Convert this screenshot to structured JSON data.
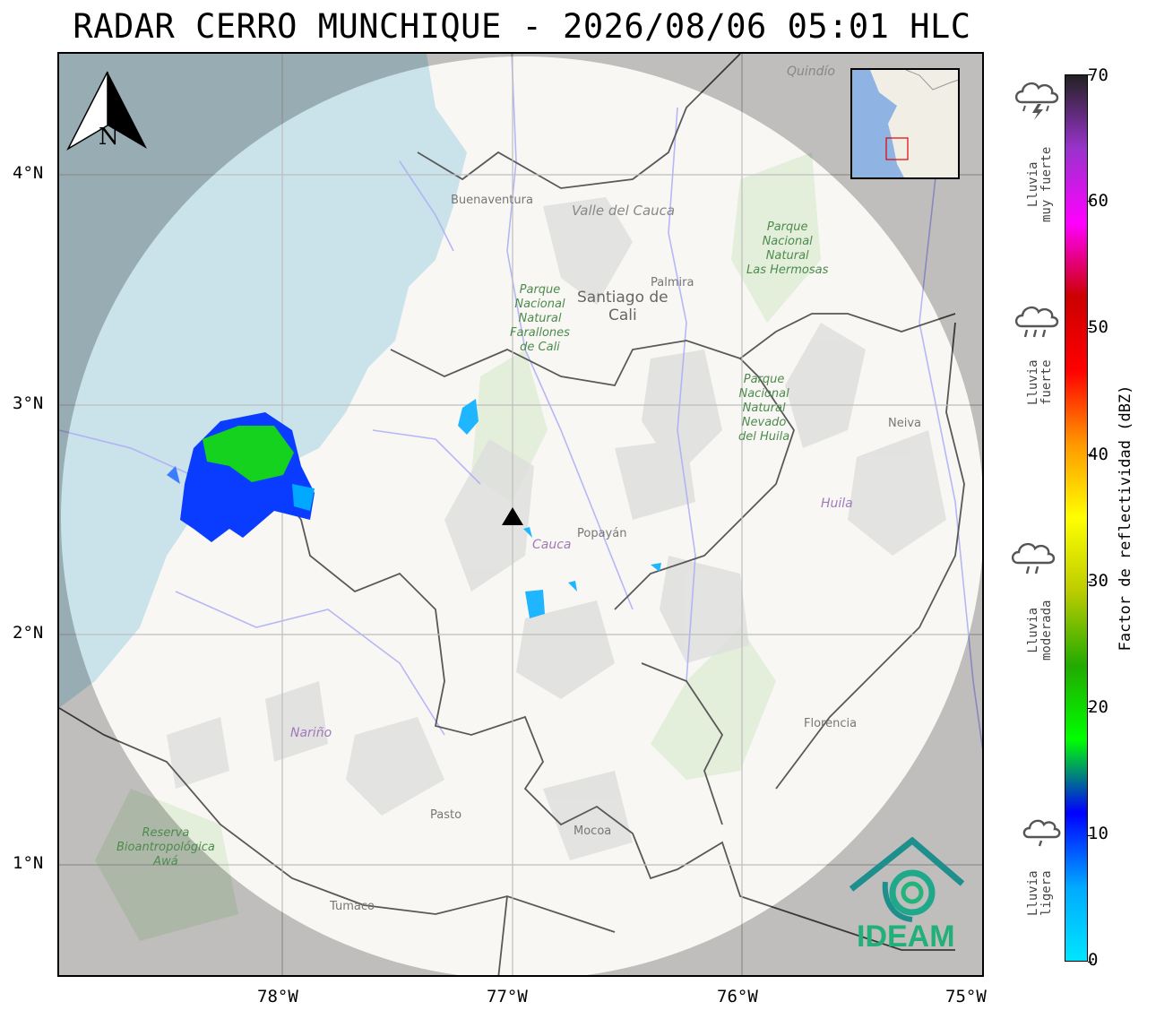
{
  "title": "RADAR CERRO MUNCHIQUE - 2026/08/06 05:01 HLC",
  "map": {
    "north_arrow_letter": "N",
    "logo_text": "IDEAM",
    "x_ticks": [
      "78°W",
      "77°W",
      "76°W",
      "75°W"
    ],
    "y_ticks": [
      "4°N",
      "3°N",
      "2°N",
      "1°N"
    ],
    "place_labels": {
      "buenaventura": "Buenaventura",
      "valle_del_cauca": "Valle del Cauca",
      "quindio": "Quindío",
      "palmira": "Palmira",
      "santiago_de_cali": "Santiago de\nCali",
      "farallones": "Parque\nNacional\nNatural\nFarallones\nde Cali",
      "las_hermosas": "Parque\nNacional\nNatural\nLas Hermosas",
      "nevado_huila": "Parque\nNacional\nNatural\nNevado\ndel Huila",
      "neiva": "Neiva",
      "popayan": "Popayán",
      "cauca": "Cauca",
      "huila": "Huila",
      "narino": "Nariño",
      "pasto": "Pasto",
      "mocoa": "Mocoa",
      "florencia": "Florencia",
      "tumaco": "Tumaco",
      "reserva": "Reserva\nBioantropológica\nAwá"
    },
    "colors": {
      "ocean": "#aed3df",
      "land": "#f4f3ef",
      "outside_range": "#7f7f7f",
      "borders": "#000000",
      "rivers": "#7f7ff2",
      "protected_areas": "#c6dfb8",
      "radar_site_marker": "#000000",
      "logo": "#1f8f8e"
    },
    "radar_site_icon": "triangle-marker-icon"
  },
  "colorbar": {
    "label": "Factor de reflectividad (dBZ)",
    "ticks": [
      "0",
      "10",
      "20",
      "30",
      "40",
      "50",
      "60",
      "70"
    ],
    "min": 0,
    "max": 70,
    "gradient_colors": [
      "#00e5ff",
      "#00aaff",
      "#0000ff",
      "#00ff00",
      "#22aa00",
      "#bbcc00",
      "#ffff00",
      "#ff9900",
      "#ff0000",
      "#cc0000",
      "#ff00ff",
      "#9933cc",
      "#222222"
    ]
  },
  "rain_legend": [
    {
      "label": "Lluvia\nmuy fuerte",
      "icon": "storm-cloud-icon"
    },
    {
      "label": "Lluvia\nfuerte",
      "icon": "heavy-rain-cloud-icon"
    },
    {
      "label": "Lluvia\nmoderada",
      "icon": "moderate-rain-cloud-icon"
    },
    {
      "label": "Lluvia\nligera",
      "icon": "light-rain-cloud-icon"
    }
  ]
}
